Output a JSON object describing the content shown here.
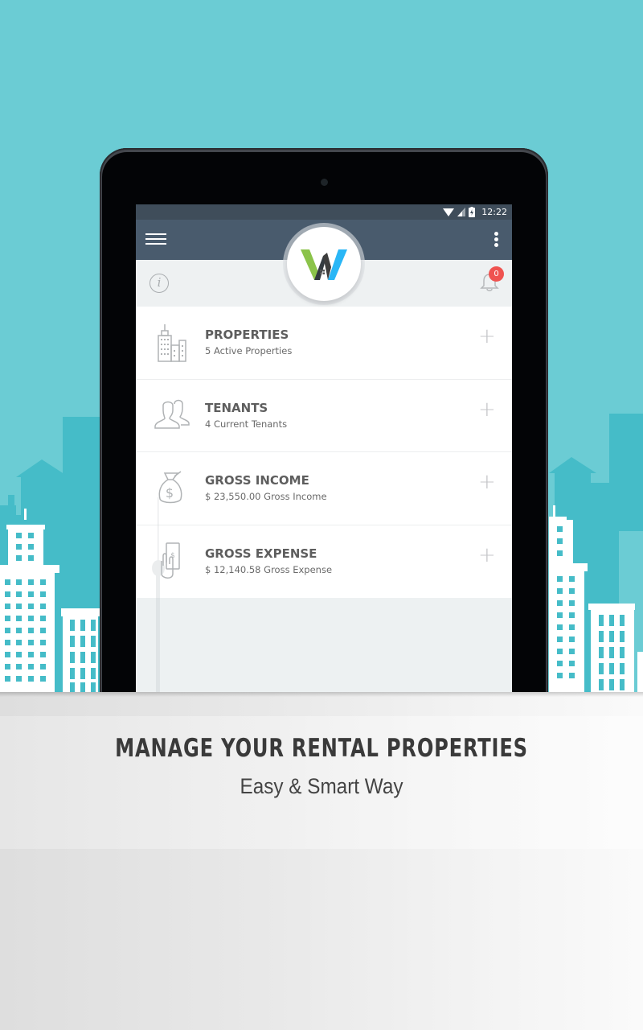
{
  "colors": {
    "background": "#6bccd4",
    "building_dark": "#45bcc8",
    "toolbar": "#495b6d",
    "statusbar": "#3f4d5a",
    "badge": "#ef5350",
    "logo_green": "#8bc34a",
    "logo_blue": "#29b6f6"
  },
  "statusbar": {
    "time": "12:22",
    "icons": [
      "wifi-icon",
      "signal-icon",
      "battery-charging-icon"
    ]
  },
  "toolbar": {
    "menu_icon": "hamburger-menu-icon",
    "logo": "W",
    "overflow_icon": "more-vert-icon"
  },
  "subbar": {
    "info_label": "i",
    "notifications_count": "0"
  },
  "dashboard": {
    "items": [
      {
        "icon": "buildings-icon",
        "title": "PROPERTIES",
        "subtitle": "5 Active Properties",
        "action": "+"
      },
      {
        "icon": "people-icon",
        "title": "TENANTS",
        "subtitle": "4 Current Tenants",
        "action": "+"
      },
      {
        "icon": "money-bag-icon",
        "title": "GROSS INCOME",
        "subtitle": "$ 23,550.00 Gross Income",
        "action": "+"
      },
      {
        "icon": "hand-cash-icon",
        "title": "GROSS EXPENSE",
        "subtitle": "$ 12,140.58 Gross Expense",
        "action": "+"
      }
    ]
  },
  "promo": {
    "headline": "MANAGE YOUR RENTAL PROPERTIES",
    "subline": "Easy & Smart Way"
  }
}
